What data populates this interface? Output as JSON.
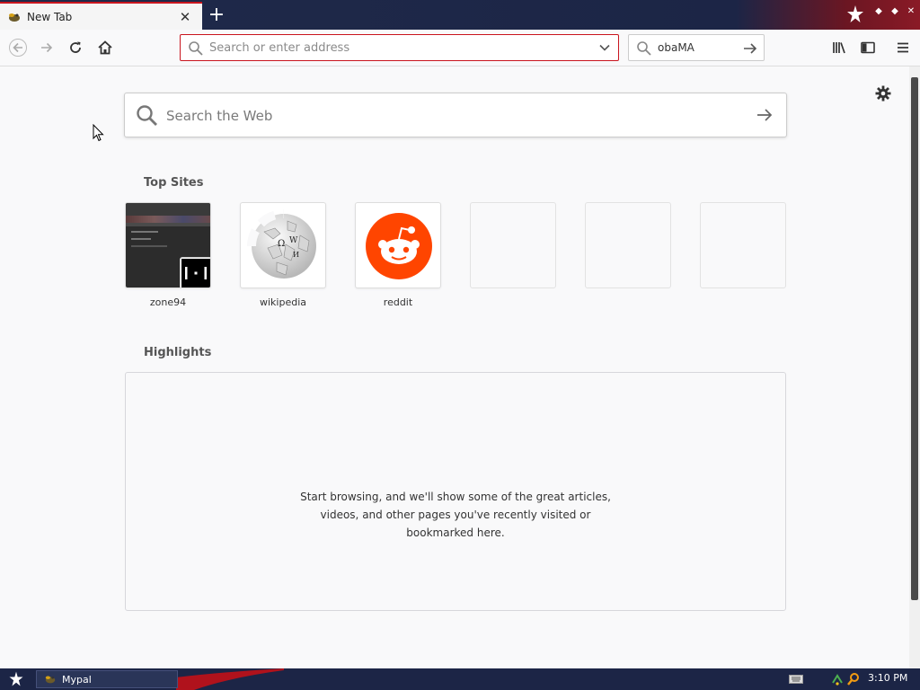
{
  "browser": {
    "tab": {
      "title": "New Tab",
      "favicon": "mypal-favicon-icon",
      "close_icon": "close-icon"
    },
    "new_tab_icon": "plus-icon",
    "url_bar": {
      "placeholder": "Search or enter address",
      "value": ""
    },
    "search_bar": {
      "value": "obaMA"
    }
  },
  "newtab": {
    "web_search": {
      "placeholder": "Search the Web"
    },
    "top_sites": {
      "title": "Top Sites",
      "sites": [
        {
          "label": "zone94"
        },
        {
          "label": "wikipedia"
        },
        {
          "label": "reddit"
        },
        {
          "label": ""
        },
        {
          "label": ""
        },
        {
          "label": ""
        }
      ]
    },
    "highlights": {
      "title": "Highlights",
      "empty_message": [
        "Start browsing, and we'll show some of the great articles,",
        "videos, and other pages you've recently visited or",
        "bookmarked here."
      ]
    }
  },
  "taskbar": {
    "task_label": "Mypal",
    "clock": "3:10 PM"
  },
  "colors": {
    "accent": "#c9151e",
    "taskbar_bg": "#1c2546",
    "reddit": "#ff4500",
    "page_bg": "#f9f9fa"
  }
}
